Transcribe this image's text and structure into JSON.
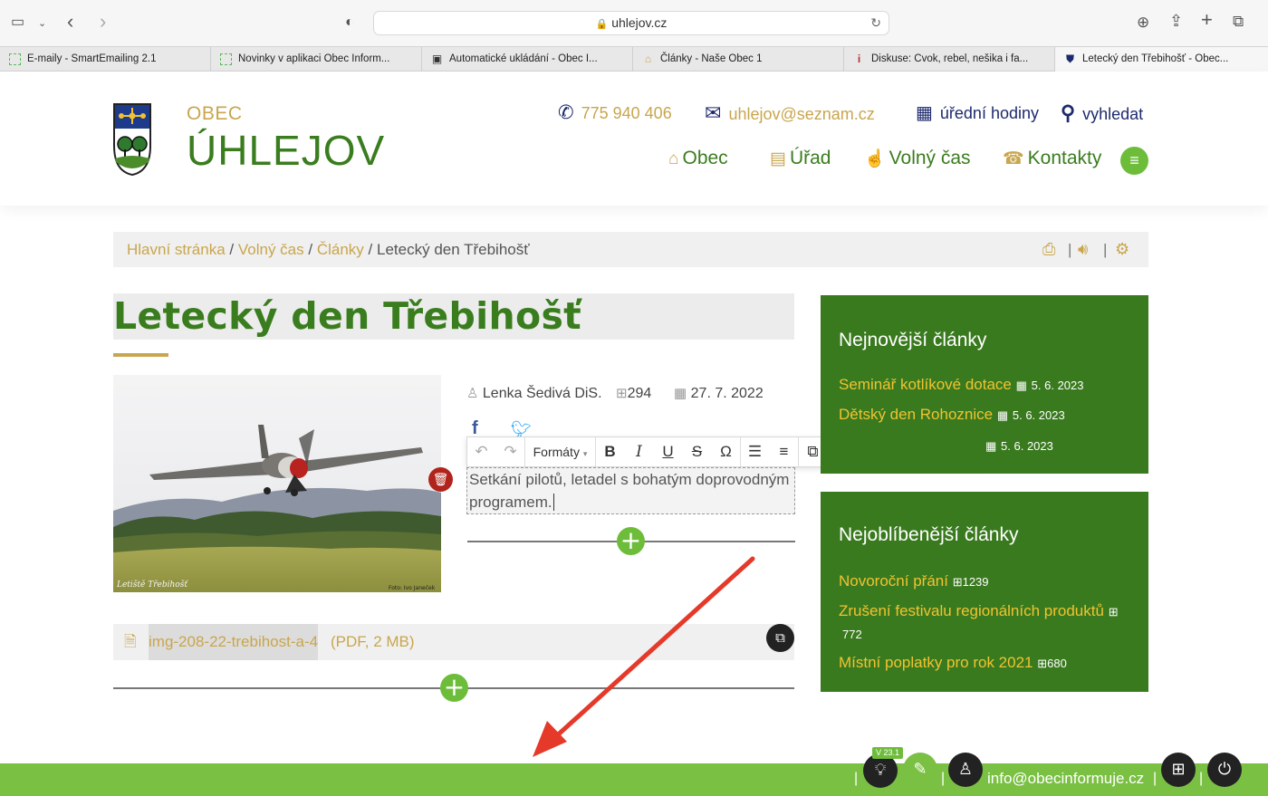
{
  "browser": {
    "url": "uhlejov.cz",
    "tabs": [
      {
        "label": "E-maily - SmartEmailing 2.1",
        "icon": "smartemailing-icon",
        "active": false
      },
      {
        "label": "Novinky v aplikaci Obec Inform...",
        "icon": "smartemailing-icon",
        "active": false
      },
      {
        "label": "Automatické ukládání - Obec I...",
        "icon": "monitor-icon",
        "active": false
      },
      {
        "label": "Články - Naše Obec 1",
        "icon": "building-icon",
        "active": false
      },
      {
        "label": "Diskuse: Cvok, rebel, nešika i fa...",
        "icon": "info-icon",
        "active": false
      },
      {
        "label": "Letecký den Třebihošť - Obec...",
        "icon": "crest-icon",
        "active": true
      }
    ]
  },
  "site": {
    "brand_top": "OBEC",
    "brand_name": "ÚHLEJOV",
    "header_links": {
      "phone": "775 940 406",
      "email": "uhlejov@seznam.cz",
      "hours": "úřední hodiny",
      "search": "vyhledat"
    },
    "nav": [
      "Obec",
      "Úřad",
      "Volný čas",
      "Kontakty"
    ]
  },
  "breadcrumb": {
    "items": [
      "Hlavní stránka",
      "Volný čas",
      "Články"
    ],
    "current": "Letecký den Třebihošť",
    "separator": "/"
  },
  "article": {
    "title": "Letecký den Třebihošť",
    "author": "Lenka Šedivá DiS.",
    "views": "294",
    "date": "27. 7. 2022",
    "photo_caption_left": "Letiště Třebihošť",
    "photo_caption_right": "Foto: Ivo Janeček",
    "body_line1": "Setkání pilotů, letadel s bohatým doprovodným",
    "body_line2": "programem.",
    "attachment_name": "img-208-22-trebihost-a-4",
    "attachment_meta": "(PDF, 2 MB)"
  },
  "editor_toolbar": {
    "formats_label": "Formáty"
  },
  "sidebar": {
    "newest_title": "Nejnovější články",
    "newest": [
      {
        "title": "Seminář kotlíkové dotace",
        "date": "5. 6. 2023"
      },
      {
        "title": "Dětský den Rohoznice",
        "date": "5. 6. 2023"
      },
      {
        "title": "",
        "date": "5. 6. 2023"
      }
    ],
    "popular_title": "Nejoblíbenější články",
    "popular": [
      {
        "title": "Novoroční přání",
        "count": "1239"
      },
      {
        "title": "Zrušení festivalu regionálních produktů",
        "count": "772"
      },
      {
        "title": "Místní poplatky pro rok 2021",
        "count": "680"
      }
    ]
  },
  "admin_bar": {
    "version": "V 23.1",
    "user_email": "info@obecinformuje.cz"
  },
  "colors": {
    "green": "#3a7d1e",
    "gold": "#c8a64e",
    "navy": "#1e2a6e",
    "bar_green": "#7ac043",
    "arrow_red": "#e5392a"
  }
}
